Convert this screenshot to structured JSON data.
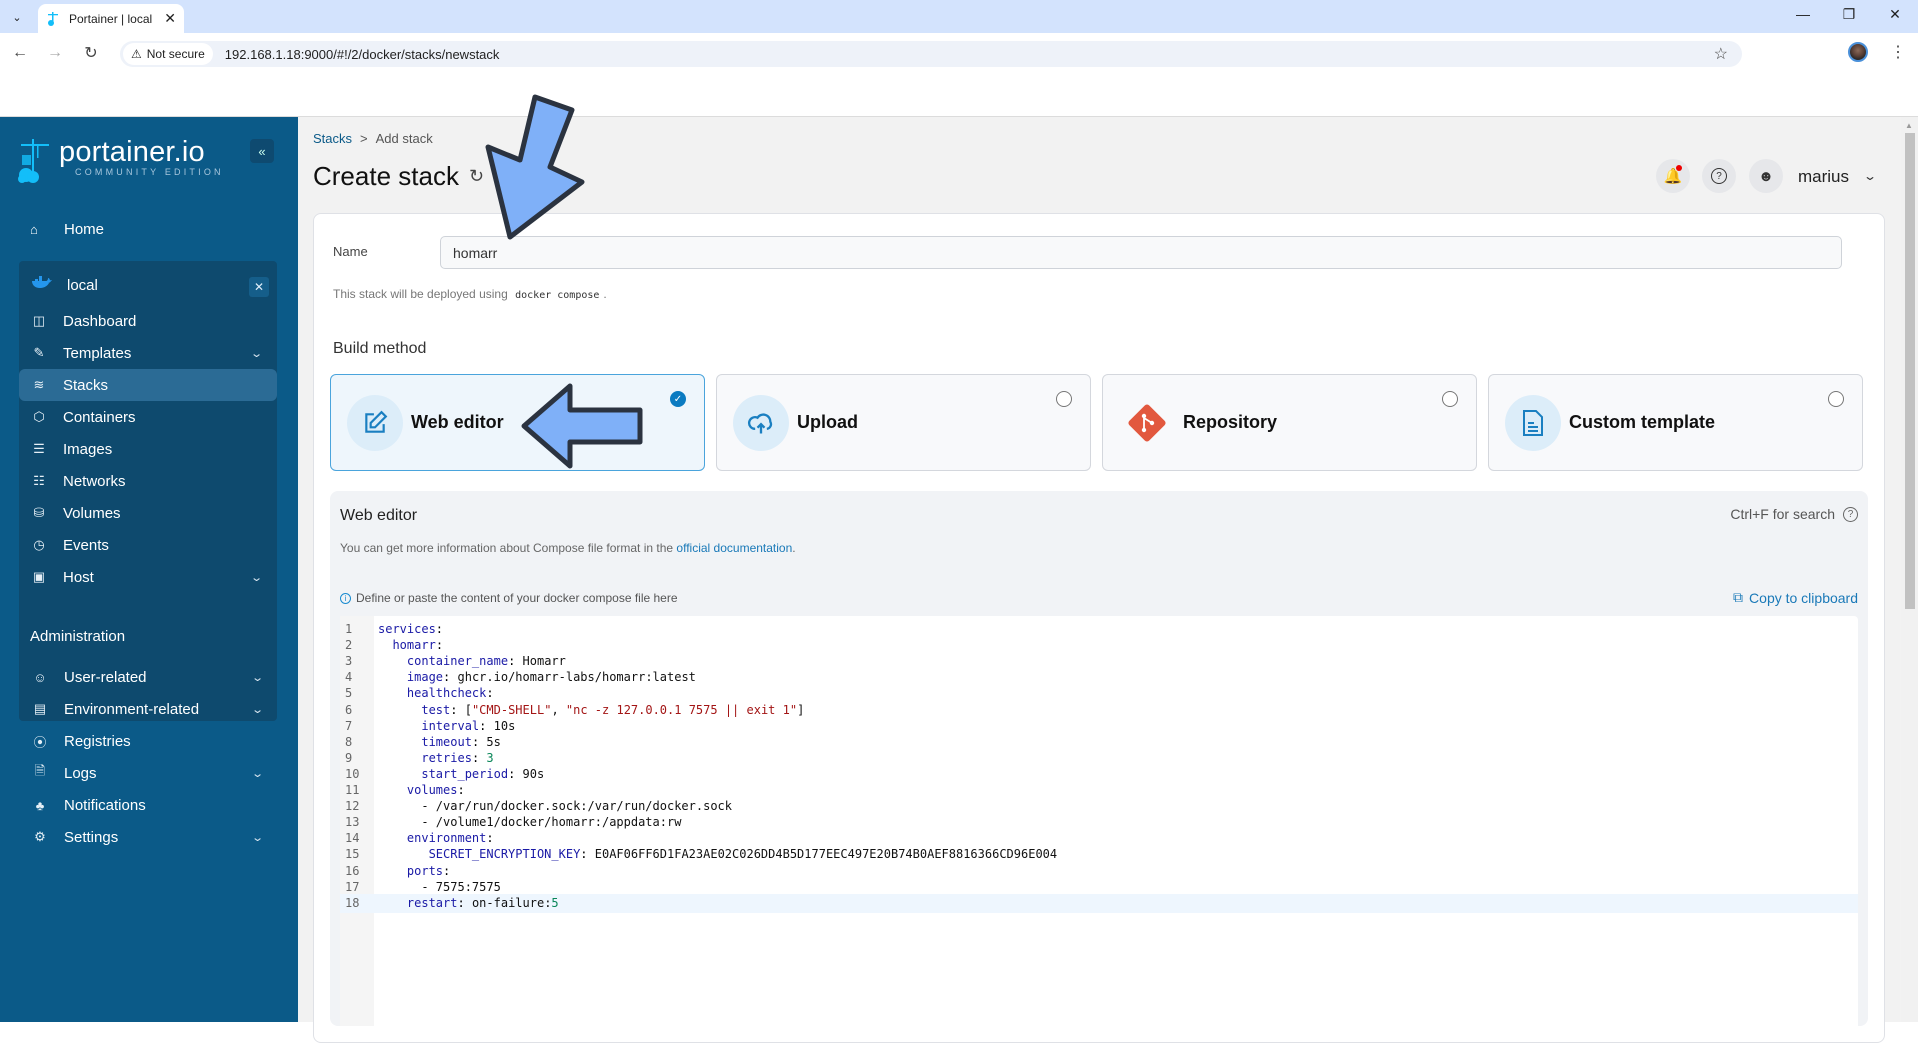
{
  "browser": {
    "tab_title": "Portainer | local",
    "not_secure_label": "Not secure",
    "url": "192.168.1.18:9000/#!/2/docker/stacks/newstack"
  },
  "sidebar": {
    "logo_text": "portainer.io",
    "logo_subtext": "COMMUNITY EDITION",
    "home_label": "Home",
    "environment": {
      "name": "local",
      "items": [
        {
          "label": "Dashboard",
          "icon": "dashboard-icon",
          "has_chevron": false,
          "active": false
        },
        {
          "label": "Templates",
          "icon": "edit-icon",
          "has_chevron": true,
          "active": false
        },
        {
          "label": "Stacks",
          "icon": "layers-icon",
          "has_chevron": false,
          "active": true
        },
        {
          "label": "Containers",
          "icon": "box-icon",
          "has_chevron": false,
          "active": false
        },
        {
          "label": "Images",
          "icon": "list-icon",
          "has_chevron": false,
          "active": false
        },
        {
          "label": "Networks",
          "icon": "network-icon",
          "has_chevron": false,
          "active": false
        },
        {
          "label": "Volumes",
          "icon": "database-icon",
          "has_chevron": false,
          "active": false
        },
        {
          "label": "Events",
          "icon": "clock-icon",
          "has_chevron": false,
          "active": false
        },
        {
          "label": "Host",
          "icon": "host-icon",
          "has_chevron": true,
          "active": false
        }
      ]
    },
    "admin_title": "Administration",
    "admin_items": [
      {
        "label": "User-related",
        "icon": "users-icon",
        "has_chevron": true
      },
      {
        "label": "Environment-related",
        "icon": "hard-drive-icon",
        "has_chevron": true
      },
      {
        "label": "Registries",
        "icon": "radio-icon",
        "has_chevron": false
      },
      {
        "label": "Logs",
        "icon": "file-text-icon",
        "has_chevron": true
      },
      {
        "label": "Notifications",
        "icon": "bell-icon",
        "has_chevron": false
      },
      {
        "label": "Settings",
        "icon": "settings-icon",
        "has_chevron": true
      }
    ]
  },
  "header": {
    "breadcrumb_root": "Stacks",
    "breadcrumb_sep": ">",
    "breadcrumb_current": "Add stack",
    "title": "Create stack",
    "username": "marius"
  },
  "form": {
    "name_label": "Name",
    "name_value": "homarr",
    "hint_prefix": "This stack will be deployed using",
    "hint_code": "docker compose",
    "hint_suffix": ".",
    "build_method_title": "Build method",
    "build_methods": [
      {
        "label": "Web editor",
        "icon": "edit-icon",
        "selected": true
      },
      {
        "label": "Upload",
        "icon": "upload-cloud-icon",
        "selected": false
      },
      {
        "label": "Repository",
        "icon": "git-icon",
        "selected": false
      },
      {
        "label": "Custom template",
        "icon": "file-icon",
        "selected": false
      }
    ]
  },
  "editor": {
    "title": "Web editor",
    "search_hint": "Ctrl+F for search",
    "info_prefix": "You can get more information about Compose file format in the",
    "info_link": "official documentation",
    "info_suffix": ".",
    "define_hint": "Define or paste the content of your docker compose file here",
    "copy_label": "Copy to clipboard",
    "active_line": 18,
    "lines": [
      "services:",
      "  homarr:",
      "    container_name: Homarr",
      "    image: ghcr.io/homarr-labs/homarr:latest",
      "    healthcheck:",
      "      test: [\"CMD-SHELL\", \"nc -z 127.0.0.1 7575 || exit 1\"]",
      "      interval: 10s",
      "      timeout: 5s",
      "      retries: 3",
      "      start_period: 90s",
      "    volumes:",
      "      - /var/run/docker.sock:/var/run/docker.sock",
      "      - /volume1/docker/homarr:/appdata:rw",
      "    environment:",
      "       SECRET_ENCRYPTION_KEY: E0AF06FF6D1FA23AE02C026DD4B5D177EEC497E20B74B0AEF8816366CD96E004",
      "    ports:",
      "      - 7575:7575",
      "    restart: on-failure:5"
    ]
  },
  "colors": {
    "sidebar_bg": "#0b5a88",
    "accent": "#0b7bc1",
    "annotation_arrow": "#7fb0f8"
  }
}
